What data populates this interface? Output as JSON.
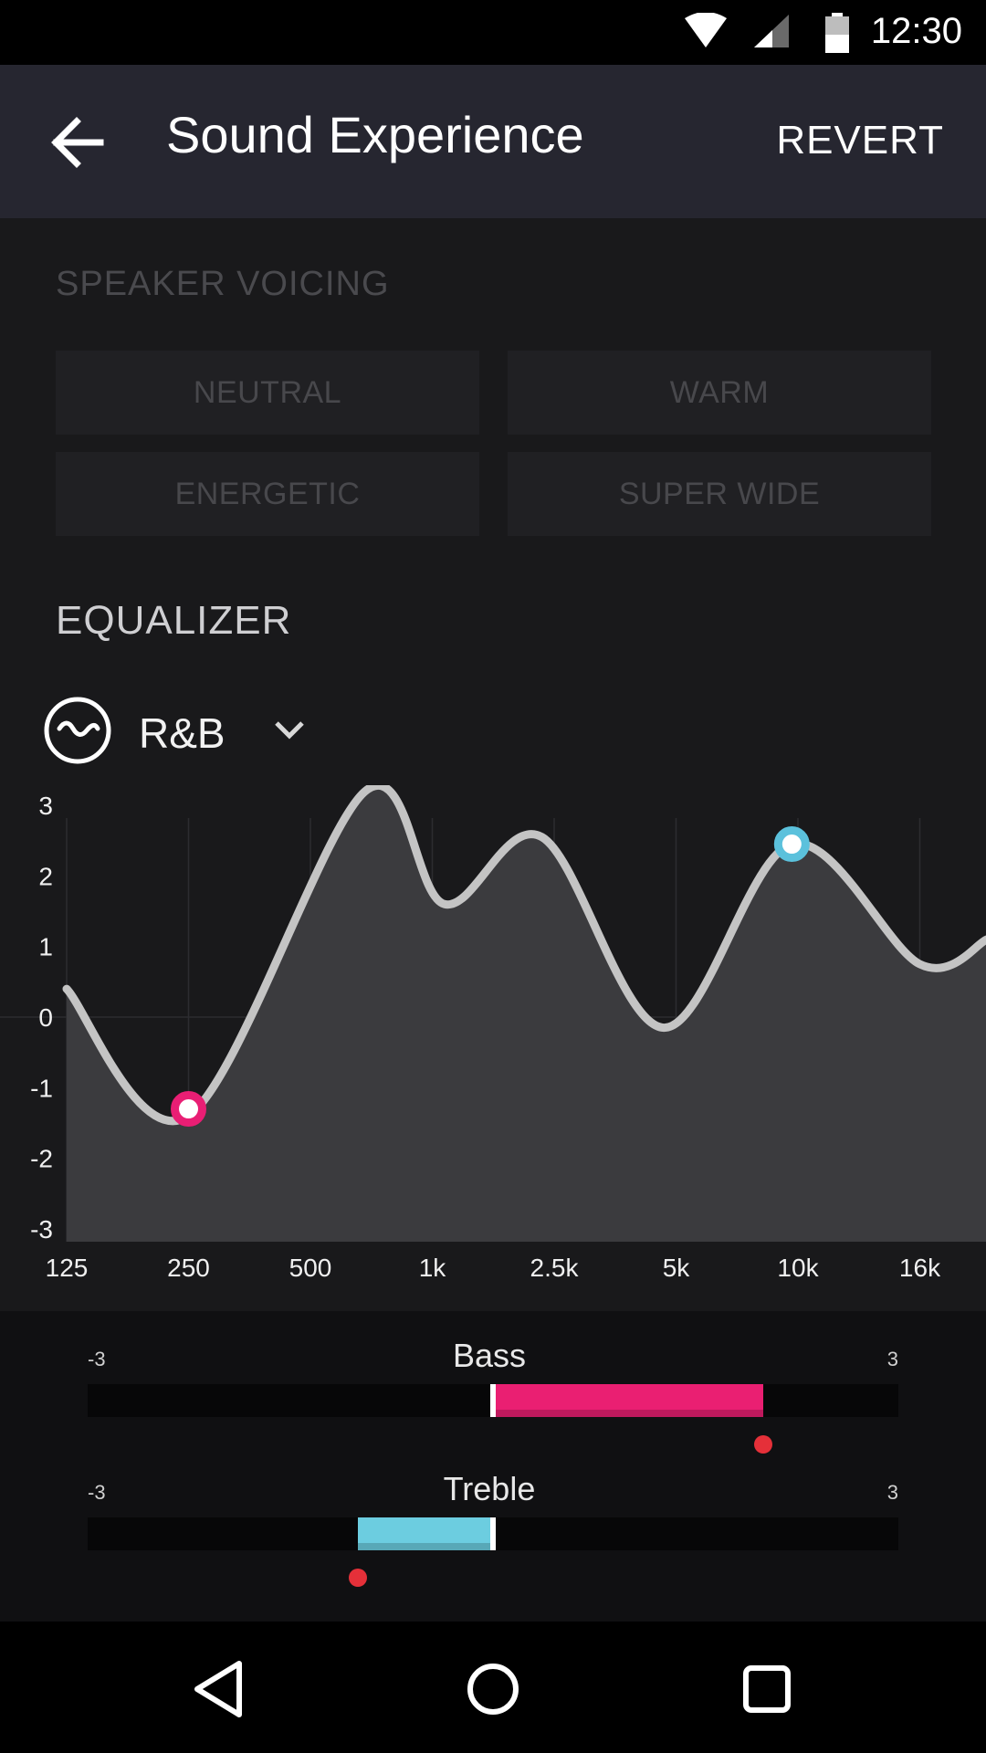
{
  "status_bar": {
    "time": "12:30",
    "icons": [
      "wifi-icon",
      "cell-signal-icon",
      "battery-icon"
    ]
  },
  "app_bar": {
    "title": "Sound Experience",
    "revert_label": "REVERT",
    "back_icon": "arrow-left-icon"
  },
  "speaker_voicing": {
    "header": "SPEAKER VOICING",
    "options": [
      "NEUTRAL",
      "WARM",
      "ENERGETIC",
      "SUPER WIDE"
    ]
  },
  "equalizer": {
    "header": "EQUALIZER",
    "preset_icon": "wave-circle-icon",
    "preset": "R&B",
    "dropdown_icon": "chevron-down-icon"
  },
  "chart_data": {
    "type": "area",
    "x_tick_labels": [
      "125",
      "250",
      "500",
      "1k",
      "2.5k",
      "5k",
      "10k",
      "16k"
    ],
    "y_tick_labels": [
      "3",
      "2",
      "1",
      "0",
      "-1",
      "-2",
      "-3"
    ],
    "ylim": [
      -3,
      3
    ],
    "grid": true,
    "curve": [
      {
        "x": 0,
        "y": 0.4
      },
      {
        "x": 1,
        "y": -1.4
      },
      {
        "x": 2.45,
        "y": 3.2
      },
      {
        "x": 3.1,
        "y": 1.6
      },
      {
        "x": 3.9,
        "y": 2.55
      },
      {
        "x": 4.9,
        "y": -0.15
      },
      {
        "x": 5.95,
        "y": 2.45
      },
      {
        "x": 7.0,
        "y": 0.75
      },
      {
        "x": 7.55,
        "y": 1.1
      }
    ],
    "handles": [
      {
        "x": 1,
        "y": -1.3,
        "color": "#e91e74"
      },
      {
        "x": 5.95,
        "y": 2.45,
        "color": "#5bc1dc"
      }
    ],
    "colors": {
      "line": "#c4c4c4",
      "fill": "#3b3b3e"
    }
  },
  "tone": {
    "bass": {
      "label": "Bass",
      "min": "-3",
      "max": "3",
      "value": 2.0,
      "target": 2.0,
      "color": "#ea1f72"
    },
    "treble": {
      "label": "Treble",
      "min": "-3",
      "max": "3",
      "value": -1.0,
      "target": -1.0,
      "color": "#6ccde0"
    }
  },
  "nav_bar": {
    "icons": [
      "back-triangle-icon",
      "home-circle-icon",
      "recents-square-icon"
    ]
  }
}
